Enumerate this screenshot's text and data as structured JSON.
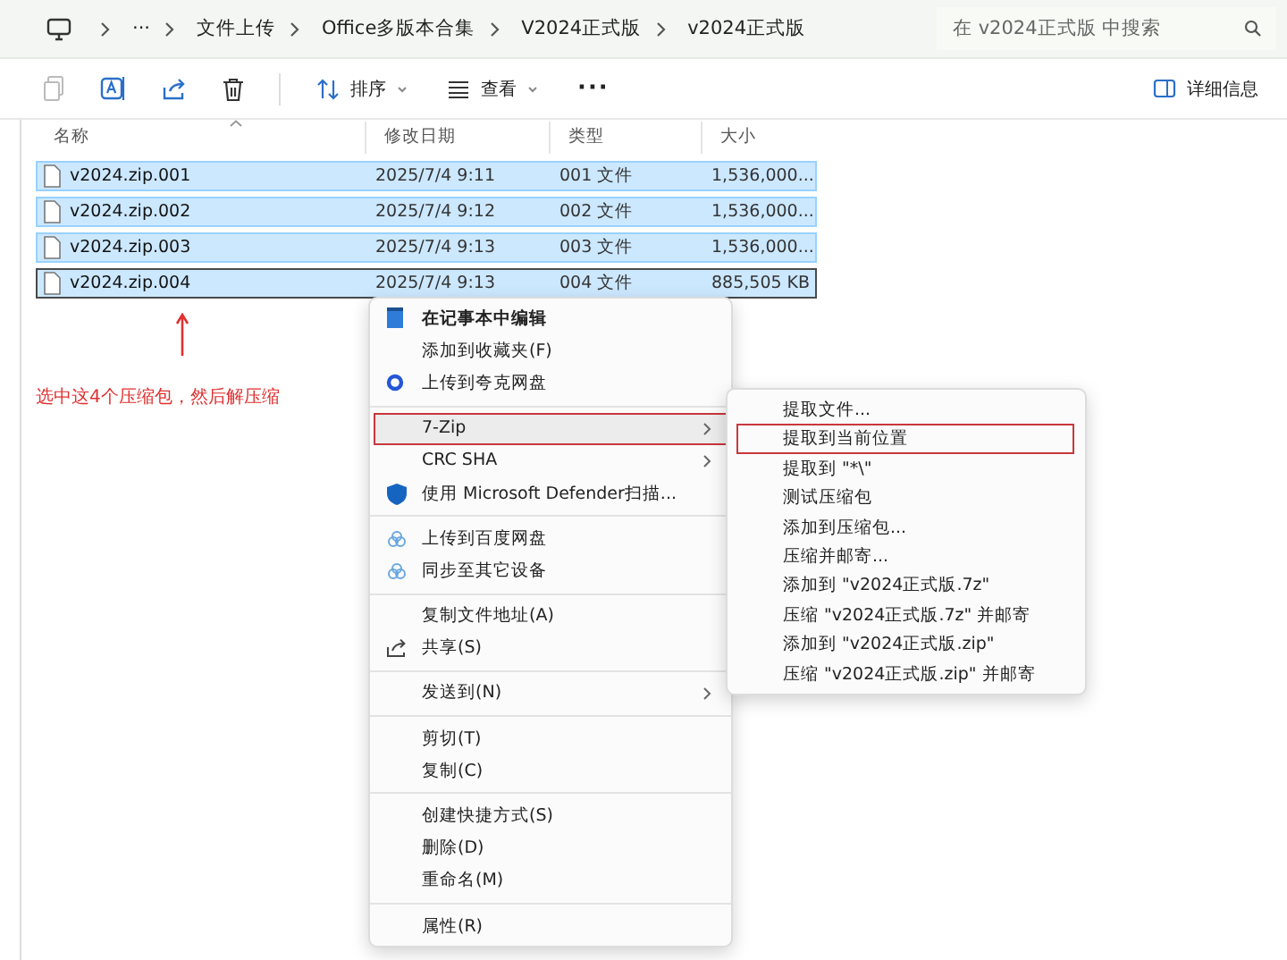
{
  "address_bar": {
    "overflow": "···",
    "crumbs": [
      "文件上传",
      "Office多版本合集",
      "V2024正式版",
      "v2024正式版"
    ]
  },
  "search": {
    "placeholder": "在 v2024正式版 中搜索"
  },
  "toolbar": {
    "sort": "排序",
    "view": "查看",
    "more": "···",
    "details": "详细信息"
  },
  "table": {
    "columns": [
      "名称",
      "修改日期",
      "类型",
      "大小"
    ],
    "rows": [
      {
        "name": "v2024.zip.001",
        "date": "2025/7/4 9:11",
        "type": "001 文件",
        "size": "1,536,000...",
        "selected": true,
        "focused": false
      },
      {
        "name": "v2024.zip.002",
        "date": "2025/7/4 9:12",
        "type": "002 文件",
        "size": "1,536,000...",
        "selected": true,
        "focused": false
      },
      {
        "name": "v2024.zip.003",
        "date": "2025/7/4 9:13",
        "type": "003 文件",
        "size": "1,536,000...",
        "selected": true,
        "focused": false
      },
      {
        "name": "v2024.zip.004",
        "date": "2025/7/4 9:13",
        "type": "004 文件",
        "size": "885,505 KB",
        "selected": true,
        "focused": true
      }
    ]
  },
  "annotation": "选中这4个压缩包，然后解压缩",
  "context_menu": [
    [
      {
        "label": "在记事本中编辑",
        "bold": true,
        "submenu": false,
        "selected": false
      },
      {
        "label": "添加到收藏夹(F)",
        "bold": false,
        "submenu": false,
        "selected": false
      },
      {
        "label": "上传到夸克网盘",
        "bold": false,
        "submenu": false,
        "selected": false
      }
    ],
    [
      {
        "label": "7-Zip",
        "bold": false,
        "submenu": true,
        "selected": true
      },
      {
        "label": "CRC SHA",
        "bold": false,
        "submenu": true,
        "selected": false
      },
      {
        "label": "使用 Microsoft Defender扫描...",
        "bold": false,
        "submenu": false,
        "selected": false
      }
    ],
    [
      {
        "label": "上传到百度网盘",
        "bold": false,
        "submenu": false,
        "selected": false
      },
      {
        "label": "同步至其它设备",
        "bold": false,
        "submenu": false,
        "selected": false
      }
    ],
    [
      {
        "label": "复制文件地址(A)",
        "bold": false,
        "submenu": false,
        "selected": false
      },
      {
        "label": "共享(S)",
        "bold": false,
        "submenu": false,
        "selected": false
      }
    ],
    [
      {
        "label": "发送到(N)",
        "bold": false,
        "submenu": true,
        "selected": false
      }
    ],
    [
      {
        "label": "剪切(T)",
        "bold": false,
        "submenu": false,
        "selected": false
      },
      {
        "label": "复制(C)",
        "bold": false,
        "submenu": false,
        "selected": false
      }
    ],
    [
      {
        "label": "创建快捷方式(S)",
        "bold": false,
        "submenu": false,
        "selected": false
      },
      {
        "label": "删除(D)",
        "bold": false,
        "submenu": false,
        "selected": false
      },
      {
        "label": "重命名(M)",
        "bold": false,
        "submenu": false,
        "selected": false
      }
    ],
    [
      {
        "label": "属性(R)",
        "bold": false,
        "submenu": false,
        "selected": false
      }
    ]
  ],
  "submenu": [
    {
      "label": "提取文件...",
      "selected": false
    },
    {
      "label": "提取到当前位置",
      "selected": true
    },
    {
      "label": "提取到 \"*\\\"",
      "selected": false
    },
    {
      "label": "测试压缩包",
      "selected": false
    },
    {
      "label": "添加到压缩包...",
      "selected": false
    },
    {
      "label": "压缩并邮寄...",
      "selected": false
    },
    {
      "label": "添加到 \"v2024正式版.7z\"",
      "selected": false
    },
    {
      "label": "压缩 \"v2024正式版.7z\" 并邮寄",
      "selected": false
    },
    {
      "label": "添加到 \"v2024正式版.zip\"",
      "selected": false
    },
    {
      "label": "压缩 \"v2024正式版.zip\" 并邮寄",
      "selected": false
    }
  ]
}
